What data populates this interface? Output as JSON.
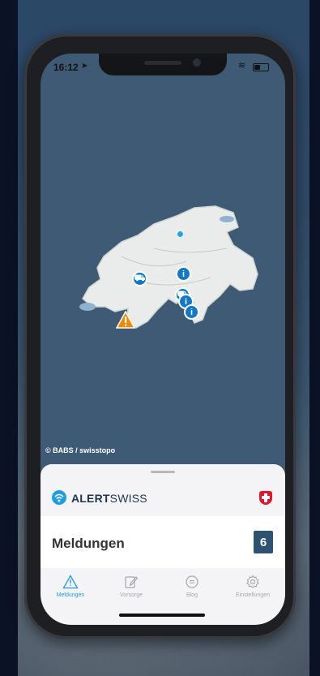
{
  "status_bar": {
    "time": "16:12"
  },
  "map": {
    "copyright": "© BABS / swisstopo"
  },
  "brand": {
    "name_bold": "ALERT",
    "name_rest": "SWISS"
  },
  "messages": {
    "title": "Meldungen",
    "count": "6"
  },
  "tabs": [
    {
      "label": "Meldungen",
      "icon": "warning-triangle-icon",
      "active": true
    },
    {
      "label": "Vorsorge",
      "icon": "pencil-note-icon",
      "active": false
    },
    {
      "label": "Blog",
      "icon": "chat-bubble-icon",
      "active": false
    },
    {
      "label": "Einstellungen",
      "icon": "gear-icon",
      "active": false
    }
  ],
  "colors": {
    "accent": "#1e9ee0",
    "marker_blue": "#1178c8",
    "warning_orange": "#f08a00",
    "count_badge": "#2f5271",
    "swiss_red": "#e3142c"
  }
}
